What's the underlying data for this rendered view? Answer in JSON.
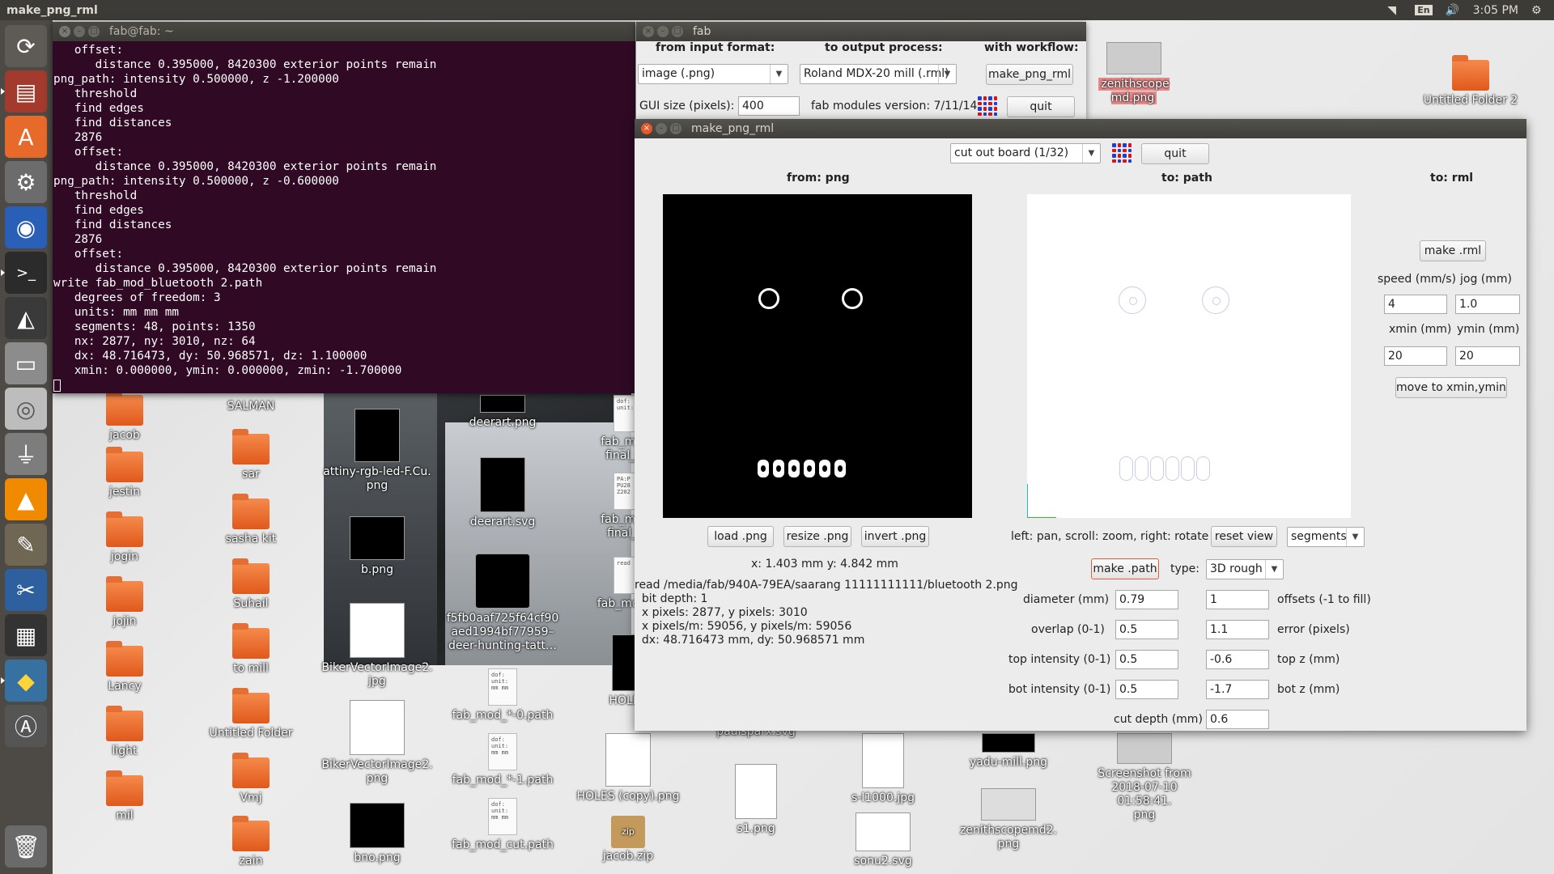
{
  "topbar": {
    "title": "make_png_rml",
    "lang": "En",
    "time": "3:05 PM"
  },
  "launcher": {
    "items": [
      "ubuntu-settings-icon",
      "files-icon",
      "software-center-icon",
      "system-settings-icon",
      "firefox-icon",
      "terminal-icon",
      "inkscape-icon",
      "drive-icon",
      "dvd-icon",
      "usb-icon",
      "vlc-icon",
      "gimp-icon",
      "video-editor-icon",
      "film-icon",
      "python-icon",
      "software-updater-icon",
      "trash-icon"
    ]
  },
  "terminal": {
    "title": "fab@fab: ~",
    "lines": [
      "   offset:",
      "      distance 0.395000, 8420300 exterior points remain",
      "png_path: intensity 0.500000, z -1.200000",
      "   threshold",
      "   find edges",
      "   find distances",
      "   2876",
      "   offset:",
      "      distance 0.395000, 8420300 exterior points remain",
      "png_path: intensity 0.500000, z -0.600000",
      "   threshold",
      "   find edges",
      "   find distances",
      "   2876",
      "   offset:",
      "      distance 0.395000, 8420300 exterior points remain",
      "write fab_mod_bluetooth 2.path",
      "   degrees of freedom: 3",
      "   units: mm mm mm",
      "   segments: 48, points: 1350",
      "   nx: 2877, ny: 3010, nz: 64",
      "   dx: 48.716473, dy: 50.968571, dz: 1.100000",
      "   xmin: 0.000000, ymin: 0.000000, zmin: -1.700000"
    ]
  },
  "fab": {
    "title": "fab",
    "from_label": "from input format:",
    "to_label": "to output process:",
    "workflow_label": "with workflow:",
    "input_format": "image (.png)",
    "output_process": "Roland MDX-20 mill (.rml)",
    "workflow_button": "make_png_rml",
    "gui_size_label": "GUI size (pixels):",
    "gui_size": "400",
    "version": "fab modules version: 7/11/14",
    "quit": "quit"
  },
  "rml": {
    "title": "make_png_rml",
    "process": "cut out board (1/32)",
    "quit": "quit",
    "from_header": "from: png",
    "to_path_header": "to: path",
    "to_rml_header": "to: rml",
    "load_png": "load .png",
    "resize_png": "resize .png",
    "invert_png": "invert .png",
    "coords": "x: 1.403 mm  y: 4.842 mm",
    "info_lines": [
      "read /media/fab/940A-79EA/saarang 11111111111/bluetooth 2.png",
      "  bit depth: 1",
      "  x pixels: 2877, y pixels: 3010",
      "  x pixels/m: 59056, y pixels/m: 59056",
      "  dx: 48.716473 mm, dy: 50.968571 mm"
    ],
    "view_hint": "left: pan, scroll: zoom, right: rotate",
    "reset_view": "reset view",
    "view_mode": "segments",
    "make_path": "make .path",
    "type_label": "type:",
    "type_value": "3D rough",
    "diameter_label": "diameter (mm)",
    "diameter": "0.79",
    "offsets": "1",
    "offsets_label": "offsets (-1 to fill)",
    "overlap_label": "overlap (0-1)",
    "overlap": "0.5",
    "error": "1.1",
    "error_label": "error (pixels)",
    "top_intensity_label": "top intensity (0-1)",
    "top_intensity": "0.5",
    "top_z": "-0.6",
    "top_z_label": "top z (mm)",
    "bot_intensity_label": "bot intensity (0-1)",
    "bot_intensity": "0.5",
    "bot_z": "-1.7",
    "bot_z_label": "bot z (mm)",
    "cut_depth_label": "cut depth (mm)",
    "cut_depth": "0.6",
    "make_rml": "make .rml",
    "speed_label": "speed (mm/s)",
    "jog_label": "jog (mm)",
    "speed": "4",
    "jog": "1.0",
    "xmin_label": "xmin (mm)",
    "ymin_label": "ymin (mm)",
    "xmin": "20",
    "ymin": "20",
    "move_button": "move to xmin,ymin"
  },
  "desktop": {
    "zenith": "zenithscope md.png",
    "untitled2": "Untitled Folder 2",
    "col1": [
      "jacob",
      "jestin",
      "jogin",
      "jojin",
      "Lancy",
      "light",
      "mil"
    ],
    "col2": [
      "SALMAN",
      "sar",
      "sasha kit",
      "Suhail",
      "to mill",
      "Untitled Folder",
      "Vmj",
      "zain"
    ],
    "col3": [
      "attiny-rgb-led-F.Cu.\npng",
      "b.png",
      "BikerVectorImage2.\njpg",
      "BikerVectorImage2.\npng",
      "bno.png"
    ],
    "col4": [
      "deerart.png",
      "deerart.svg",
      "f5fb0aaf725f64cf90\naed1994bf77959–\ndeer-hunting-tatt…",
      "fab_mod_*-0.path",
      "fab_mod_*-1.path",
      "fab_mod_cut.path"
    ],
    "col5": [
      "fab_mod_\nfinal_dri",
      "fab_mod_\nfinal_dr",
      "fab_mod_p",
      "HOLES",
      "HOLES (copy).png",
      "jacob.zip"
    ],
    "bottom": [
      "paulsparx.svg",
      "s1.png",
      "s-l1000.jpg",
      "sonu2.svg",
      "yadu-mill.png",
      "zenithscopemd2.\npng",
      "Screenshot from\n2018-07-10 01:58:41.\npng"
    ],
    "zip_tag": "zip"
  }
}
